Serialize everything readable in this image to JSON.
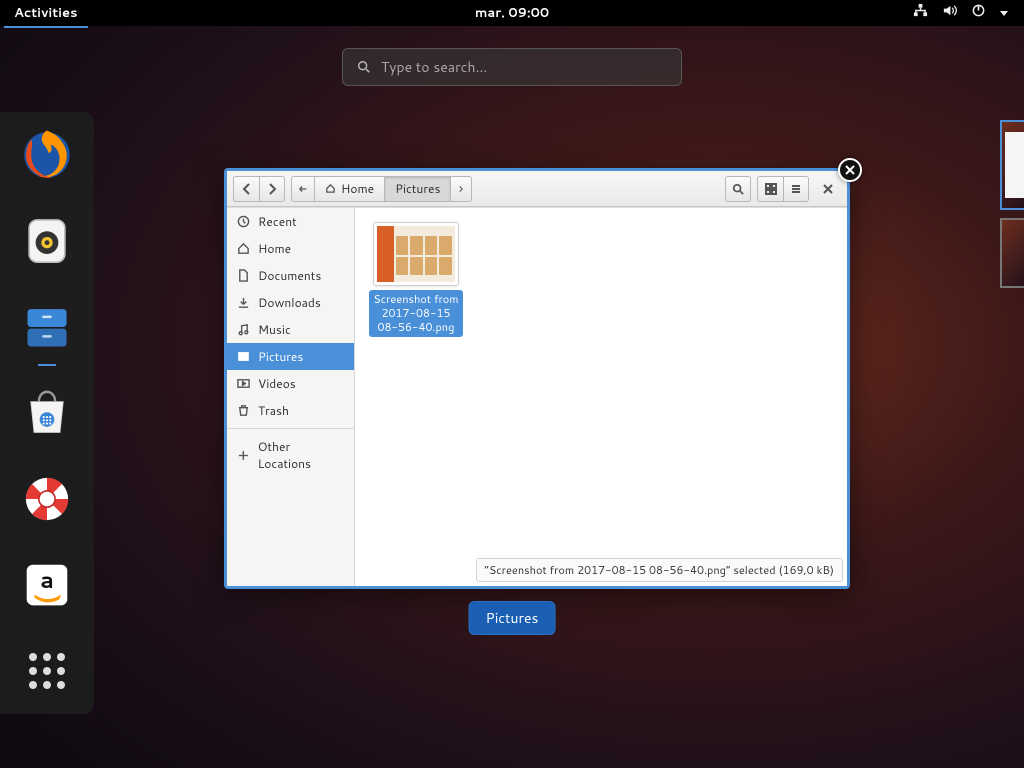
{
  "topbar": {
    "activities": "Activities",
    "clock": "mar. 09:00"
  },
  "search": {
    "placeholder": "Type to search..."
  },
  "window": {
    "title_pill": "Pictures",
    "path_home": "Home",
    "path_current": "Pictures",
    "statusbar": "“Screenshot from 2017-08-15 08-56-40.png” selected  (169,0 kB)"
  },
  "places": {
    "recent": "Recent",
    "home": "Home",
    "documents": "Documents",
    "downloads": "Downloads",
    "music": "Music",
    "pictures": "Pictures",
    "videos": "Videos",
    "trash": "Trash",
    "other": "Other Locations"
  },
  "file": {
    "name": "Screenshot from 2017-08-15 08-56-40.png"
  },
  "dash": {
    "firefox": "Firefox",
    "rhythmbox": "Rhythmbox",
    "files": "Files",
    "software": "Software",
    "help": "Help",
    "amazon": "Amazon",
    "apps": "Show Applications"
  }
}
